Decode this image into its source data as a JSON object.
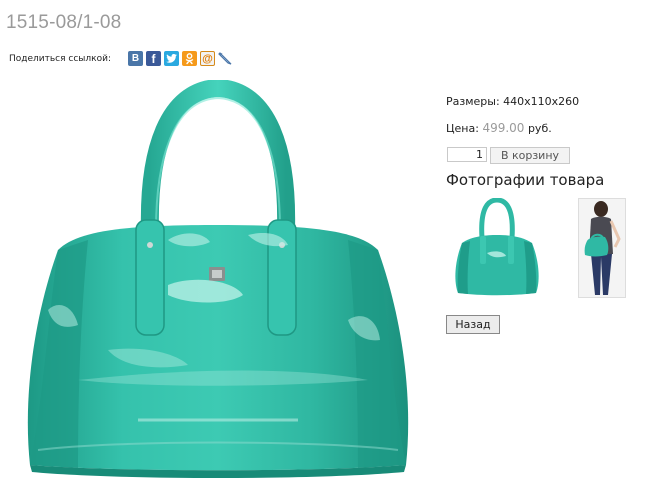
{
  "product": {
    "title": "1515-08/1-08",
    "size_label": "Размеры:",
    "size_value": "440x110x260",
    "price_label": "Цена:",
    "price_value": "499.00",
    "currency": "руб.",
    "quantity": "1",
    "add_to_cart_label": "В корзину",
    "photos_heading": "Фотографии товара",
    "back_label": "Назад",
    "bag_color": "#2fb9a4"
  },
  "share": {
    "label": "Поделиться ссылкой:",
    "icons": [
      {
        "name": "vkontakte-icon",
        "glyph": "B"
      },
      {
        "name": "facebook-icon",
        "glyph": "f"
      },
      {
        "name": "twitter-icon",
        "glyph": "t"
      },
      {
        "name": "odnoklassniki-icon",
        "glyph": "ok"
      },
      {
        "name": "mail-icon",
        "glyph": "@"
      },
      {
        "name": "livejournal-icon",
        "glyph": "✎"
      }
    ]
  }
}
